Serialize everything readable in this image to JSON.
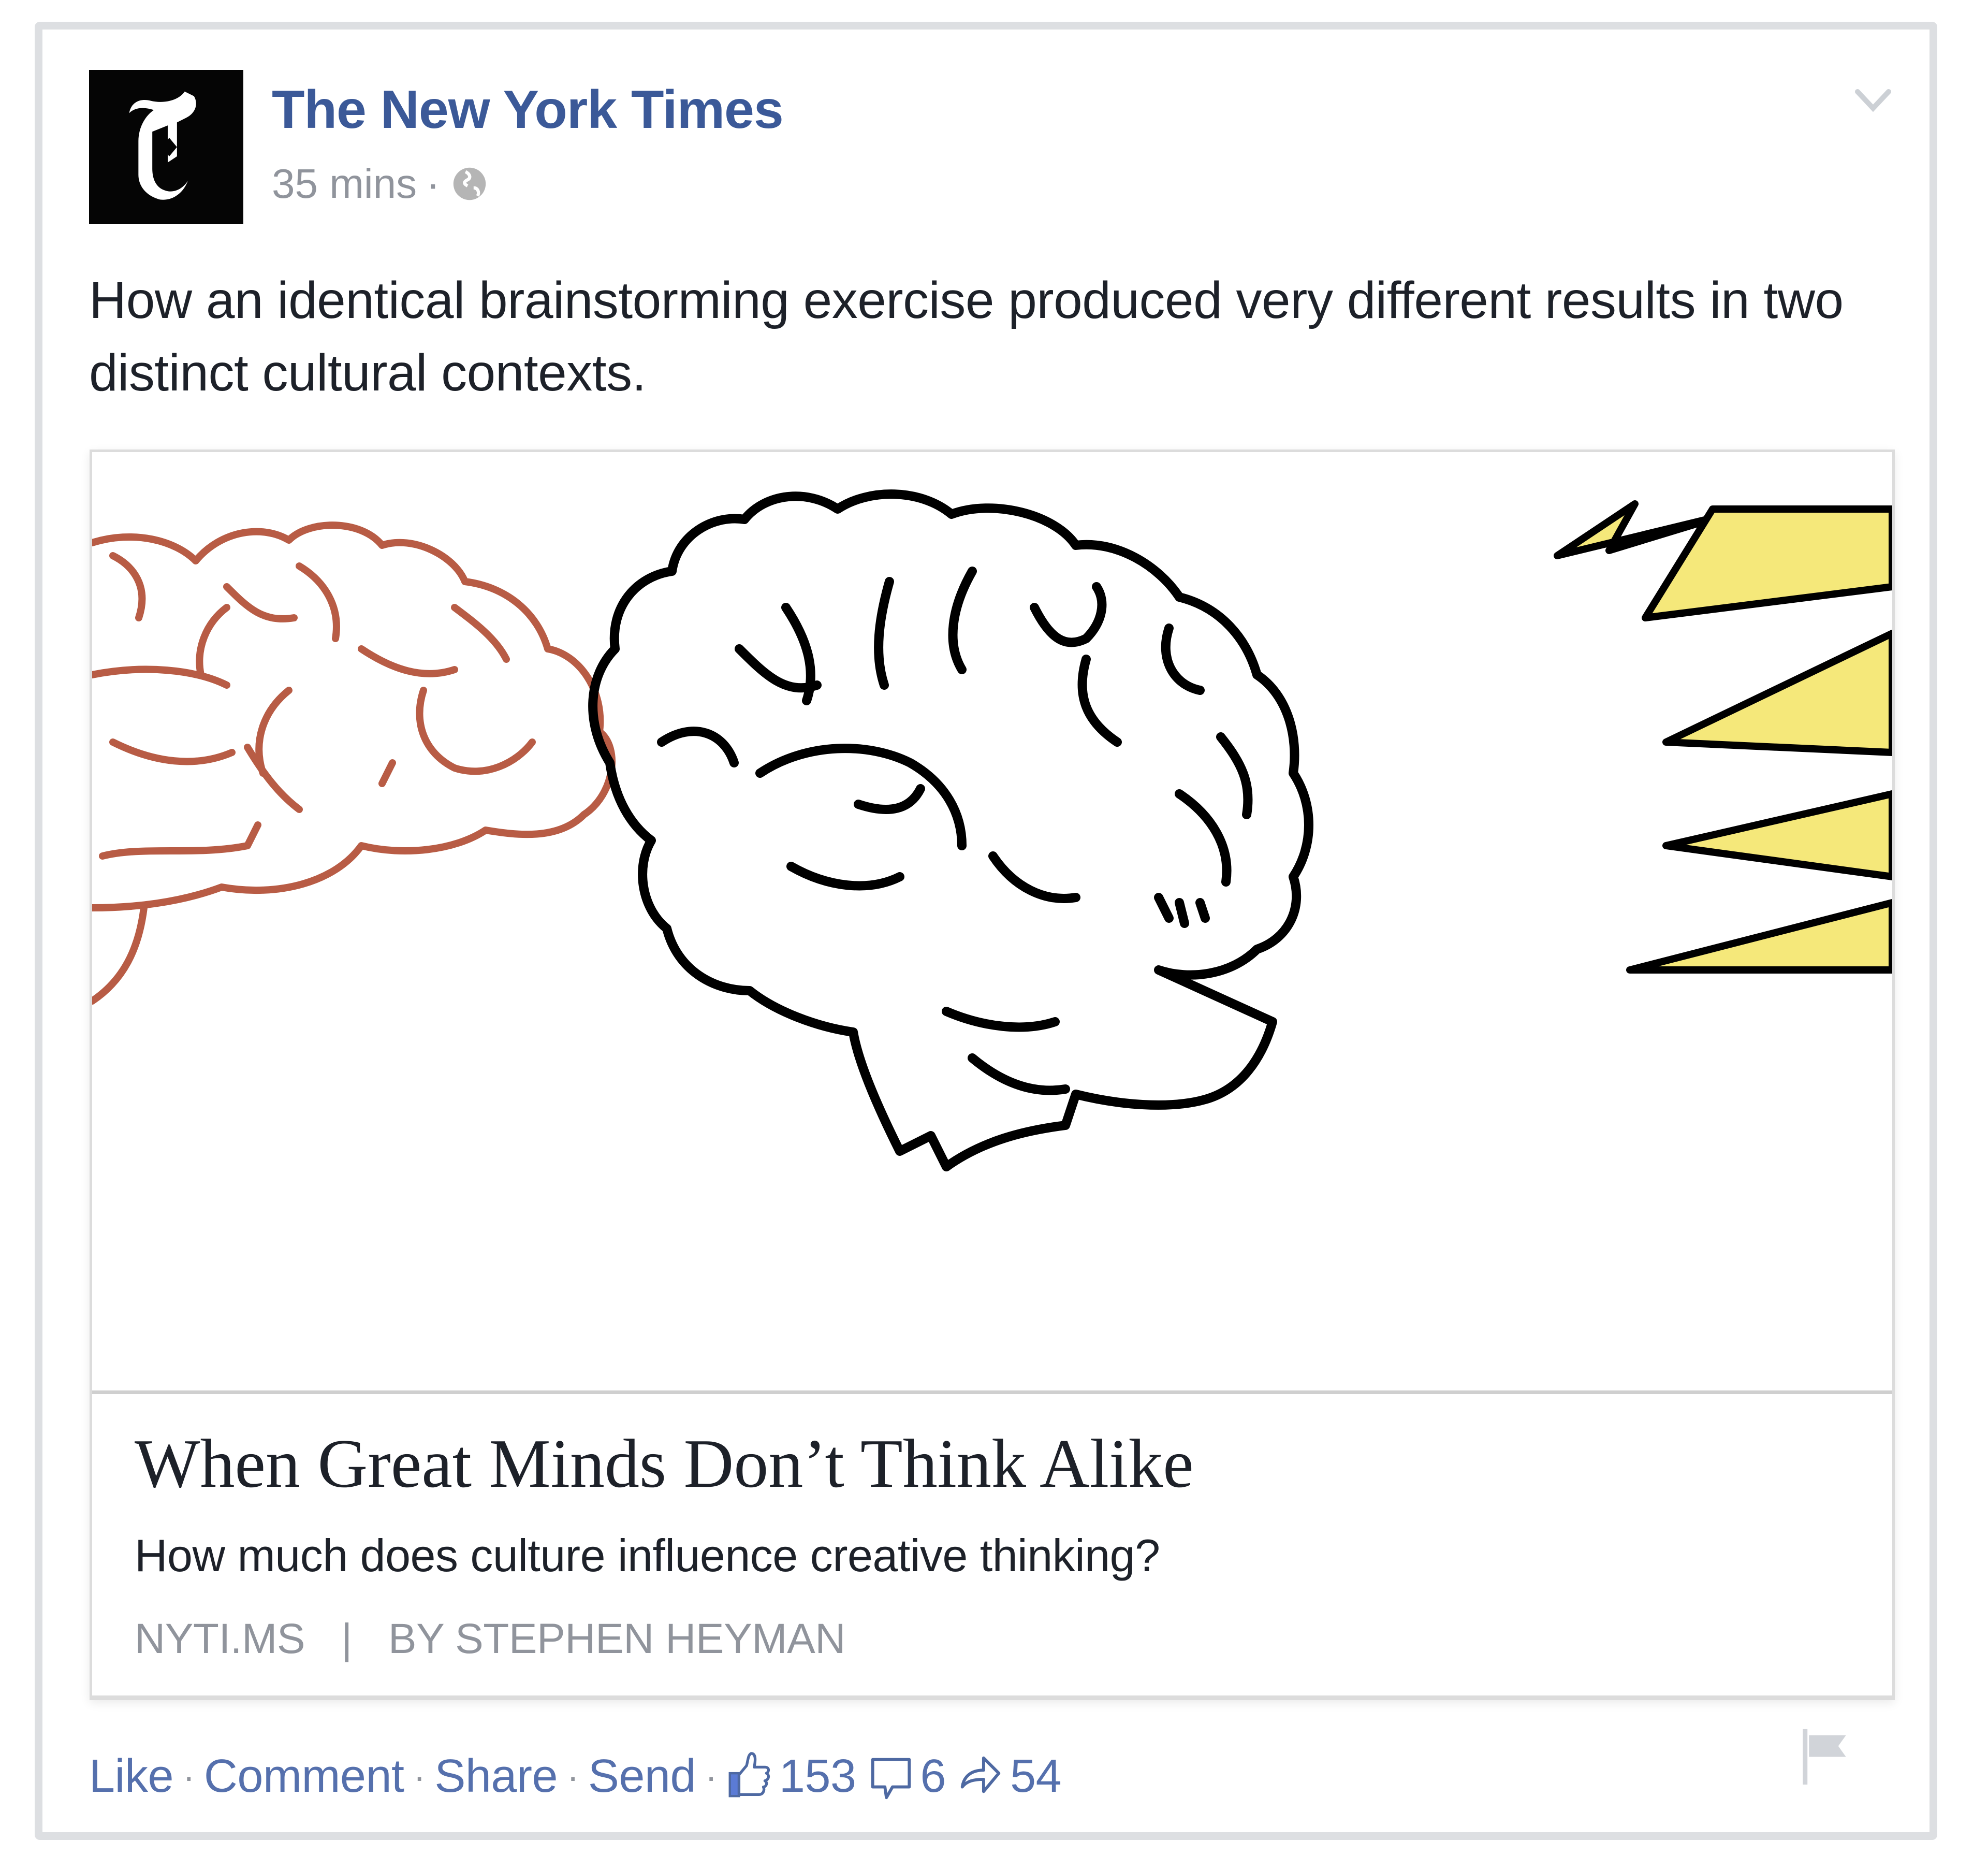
{
  "post": {
    "page_name": "The New York Times",
    "timestamp": "35 mins",
    "separator": "·",
    "privacy_icon": "globe-icon",
    "menu_icon": "chevron-down-icon",
    "text": "How an identical brainstorming exercise produced very different results in two distinct cultural contexts.",
    "avatar_icon": "nyt-logo-icon"
  },
  "link_preview": {
    "image_description": "Illustration of a terracotta brain outline, a black brain outline, and yellow triangular rays",
    "title": "When Great Minds Don’t Think Alike",
    "description": "How much does culture influence creative thinking?",
    "domain": "NYTI.MS",
    "pipe": "|",
    "byline": "BY STEPHEN HEYMAN"
  },
  "actions": {
    "like": "Like",
    "comment": "Comment",
    "share": "Share",
    "send": "Send",
    "dot": "·",
    "like_count": "153",
    "comment_count": "6",
    "share_count": "54",
    "icons": [
      "thumbs-up-icon",
      "comment-bubble-icon",
      "share-arrow-icon",
      "flag-icon"
    ]
  },
  "colors": {
    "brand_blue": "#3b5998",
    "action_blue": "#5570ad",
    "meta_gray": "#90949c",
    "text_dark": "#1d2129",
    "brain_left": "#b85c45",
    "ray_yellow": "#f5e87a"
  }
}
